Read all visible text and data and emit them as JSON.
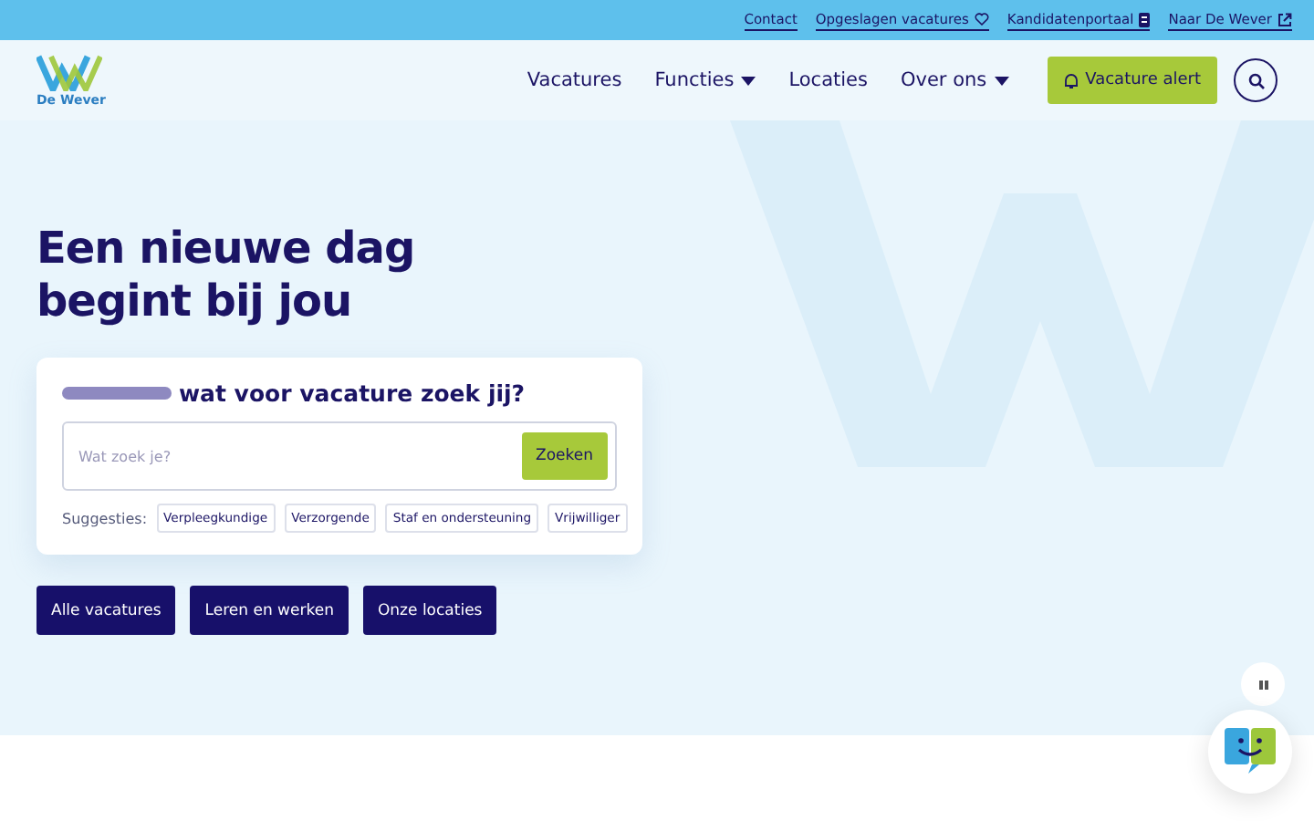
{
  "top_links": [
    {
      "label": "Contact",
      "kind": "plain"
    },
    {
      "label": "Opgeslagen vacatures",
      "kind": "saved"
    },
    {
      "label": "Kandidatenportaal",
      "kind": "portal"
    },
    {
      "label": "Naar De Wever",
      "kind": "external"
    }
  ],
  "logo": {
    "text": "De Wever"
  },
  "nav": [
    {
      "label": "Vacatures",
      "dropdown": false
    },
    {
      "label": "Functies",
      "dropdown": true
    },
    {
      "label": "Locaties",
      "dropdown": false
    },
    {
      "label": "Over ons",
      "dropdown": true
    }
  ],
  "alert_button": "Vacature alert",
  "hero": {
    "title": "Een nieuwe dag begint bij jou",
    "search": {
      "heading": "wat voor vacature zoek jij?",
      "placeholder": "Wat zoek je?",
      "button": "Zoeken",
      "suggestions_label": "Suggesties:",
      "suggestions": [
        "Verpleegkundige",
        "Verzorgende",
        "Staf en ondersteuning",
        "Vrijwilliger"
      ]
    },
    "buttons": [
      "Alle vacatures",
      "Leren en werken",
      "Onze locaties"
    ]
  }
}
